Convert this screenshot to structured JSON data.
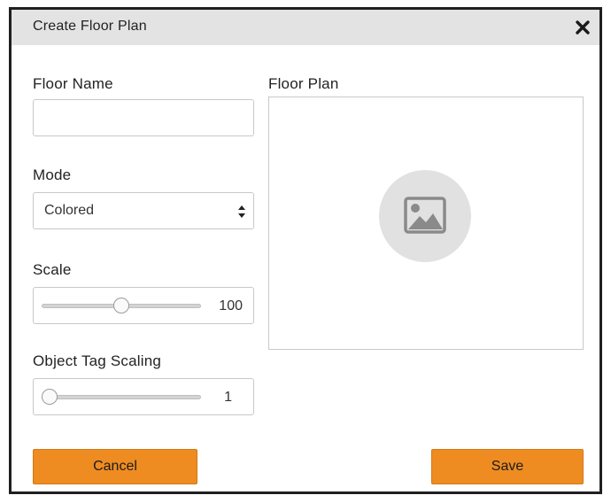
{
  "dialog": {
    "title": "Create Floor Plan",
    "close_icon": "close-icon"
  },
  "form": {
    "floor_name": {
      "label": "Floor Name",
      "value": "",
      "placeholder": ""
    },
    "mode": {
      "label": "Mode",
      "selected": "Colored"
    },
    "scale": {
      "label": "Scale",
      "value": "100",
      "level_fraction": 0.5
    },
    "object_tag_scaling": {
      "label": "Object Tag Scaling",
      "value": "1",
      "level_fraction": 0.0
    }
  },
  "floor_plan": {
    "label": "Floor Plan",
    "placeholder_icon": "image-icon"
  },
  "buttons": {
    "cancel_label": "Cancel",
    "save_label": "Save"
  },
  "colors": {
    "accent": "#ee8c22",
    "titlebar": "#e3e3e3",
    "border": "#1f1f1f"
  }
}
